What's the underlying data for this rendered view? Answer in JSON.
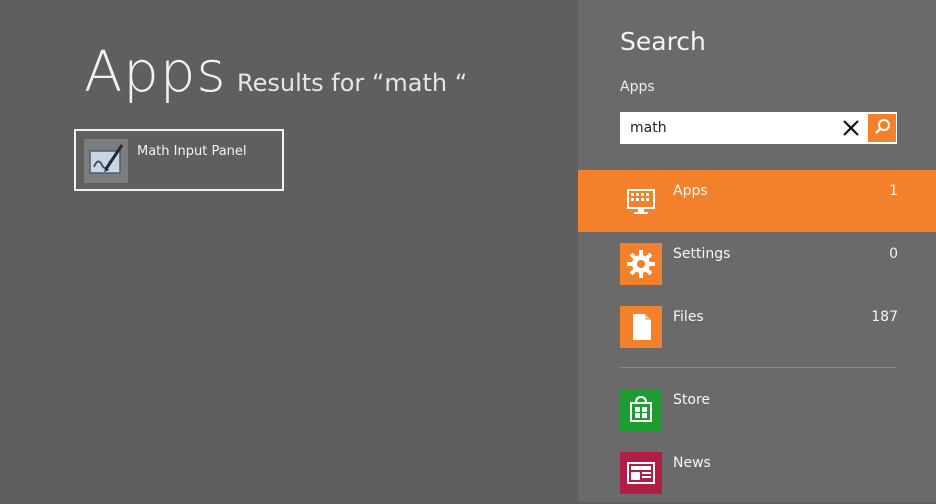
{
  "left": {
    "title": "Apps",
    "results_text": "Results for “math “",
    "results": [
      {
        "label": "Math Input Panel",
        "icon": "math-input-panel-icon"
      }
    ]
  },
  "search_pane": {
    "title": "Search",
    "scope_label": "Apps",
    "query": "math",
    "clear_icon": "close-icon",
    "go_icon": "search-icon",
    "scopes": [
      {
        "name": "Apps",
        "count": "1",
        "icon": "apps-monitor-icon",
        "active": true
      },
      {
        "name": "Settings",
        "count": "0",
        "icon": "gear-icon"
      },
      {
        "name": "Files",
        "count": "187",
        "icon": "file-icon"
      }
    ],
    "apps": [
      {
        "name": "Store",
        "icon": "store-icon"
      },
      {
        "name": "News",
        "icon": "news-icon"
      }
    ]
  },
  "colors": {
    "background": "#5f5f5f",
    "pane": "#6a6a6a",
    "accent": "#f3802a",
    "store_green": "#1e9b31",
    "news_red": "#b01e45"
  }
}
